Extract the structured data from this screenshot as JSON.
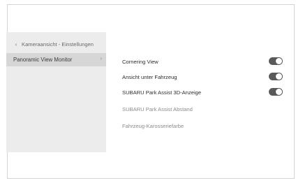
{
  "sidebar": {
    "back_label": "Kameraansicht - Einstellungen",
    "back_icon": "chevron-left-icon",
    "items": [
      {
        "label": "Panoramic View Monitor",
        "icon": "chevron-right-icon",
        "selected": true
      }
    ]
  },
  "settings": [
    {
      "label": "Cornering View",
      "toggle": "on"
    },
    {
      "label": "Ansicht unter Fahrzeug",
      "toggle": "on"
    },
    {
      "label": "SUBARU Park Assist 3D-Anzeige",
      "toggle": "on"
    },
    {
      "label": "SUBARU Park Assist Abstand"
    },
    {
      "label": "Fahrzeug-Karosseriefarbe"
    }
  ],
  "colors": {
    "sidebar_bg": "#ececec",
    "selected_bg": "#d6d6d6",
    "toggle_on": "#5a5a5a"
  }
}
